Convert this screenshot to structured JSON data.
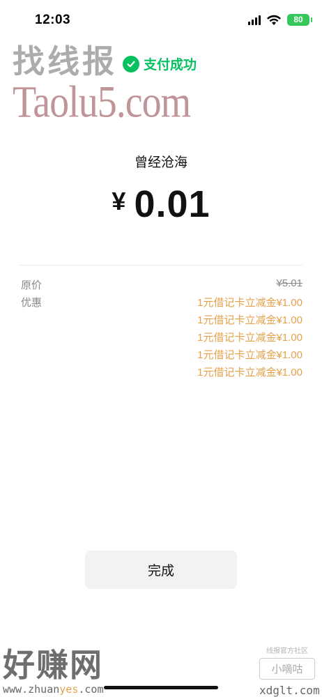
{
  "status_bar": {
    "time": "12:03",
    "battery": "80"
  },
  "watermarks": {
    "top": "找线报",
    "site": "Taolu5.com",
    "bottom_big": "好赚网",
    "bottom_url_prefix": "www.zhuan",
    "bottom_url_highlight": "yes",
    "bottom_url_suffix": ".com",
    "right_small": "线报官方社区",
    "right_box": "小嘀咕",
    "right_site": "xdglt.com"
  },
  "payment": {
    "status": "支付成功",
    "merchant": "曾经沧海",
    "currency": "¥",
    "amount": "0.01"
  },
  "details": {
    "original_label": "原价",
    "original_value": "¥5.01",
    "discount_label": "优惠",
    "discounts": [
      "1元借记卡立减金¥1.00",
      "1元借记卡立减金¥1.00",
      "1元借记卡立减金¥1.00",
      "1元借记卡立减金¥1.00",
      "1元借记卡立减金¥1.00"
    ]
  },
  "actions": {
    "done": "完成"
  },
  "colors": {
    "success_green": "#07c160",
    "discount_orange": "#e5a14a"
  }
}
